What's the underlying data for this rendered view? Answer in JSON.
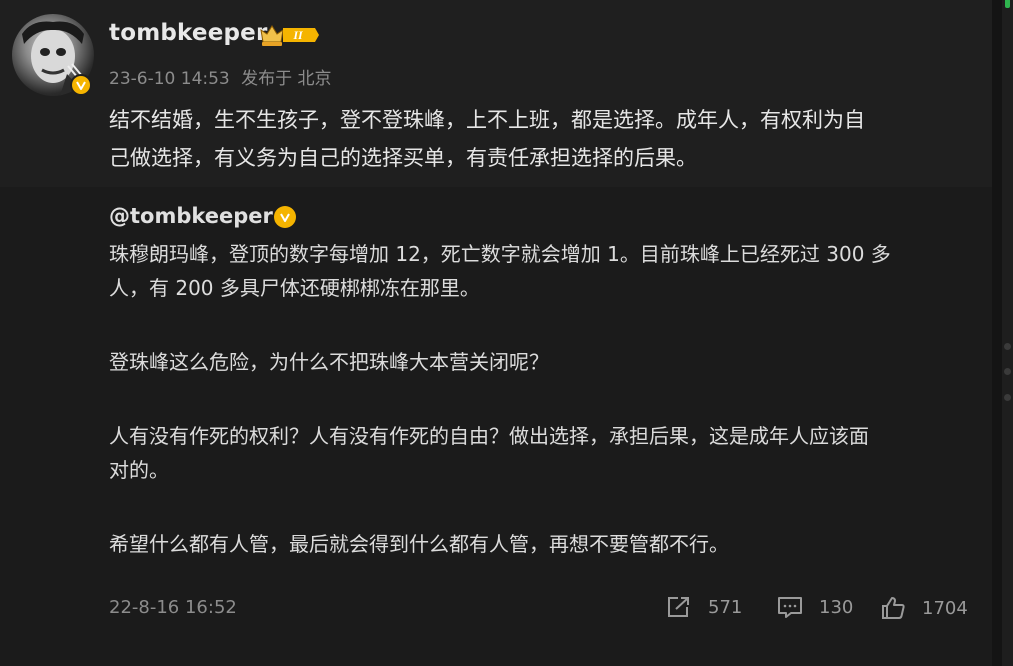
{
  "post": {
    "username": "tombkeeper",
    "vip_icon": "crown-vip-level-II-icon",
    "vip_level_text": "II",
    "timestamp": "23-6-10 14:53",
    "location": "发布于 北京",
    "text_line1": "结不结婚，生不生孩子，登不登珠峰，上不上班，都是选择。成年人，有权利为自",
    "text_line2": "己做选择，有义务为自己的选择买单，有责任承担选择的后果。"
  },
  "repost": {
    "author": "@tombkeeper",
    "para1_line1": "珠穆朗玛峰，登顶的数字每增加 12，死亡数字就会增加 1。目前珠峰上已经死过 300 多",
    "para1_line2": "人，有 200 多具尸体还硬梆梆冻在那里。",
    "para2": "登珠峰这么危险，为什么不把珠峰大本营关闭呢？",
    "para3_line1": "人有没有作死的权利？人有没有作死的自由？做出选择，承担后果，这是成年人应该面",
    "para3_line2": "对的。",
    "para4": "希望什么都有人管，最后就会得到什么都有人管，再想不要管都不行。",
    "timestamp": "22-8-16 16:52",
    "shares": "571",
    "comments": "130",
    "likes": "1704"
  },
  "colors": {
    "background": "#141414",
    "card": "#1b1b1b",
    "verified_badge": "#f5b400",
    "scroll_accent": "#2fb54f",
    "meta_text": "#8c8c8c"
  },
  "icons": [
    "avatar",
    "verified-icon",
    "crown-vip-icon",
    "share-icon",
    "comment-icon",
    "like-icon"
  ]
}
